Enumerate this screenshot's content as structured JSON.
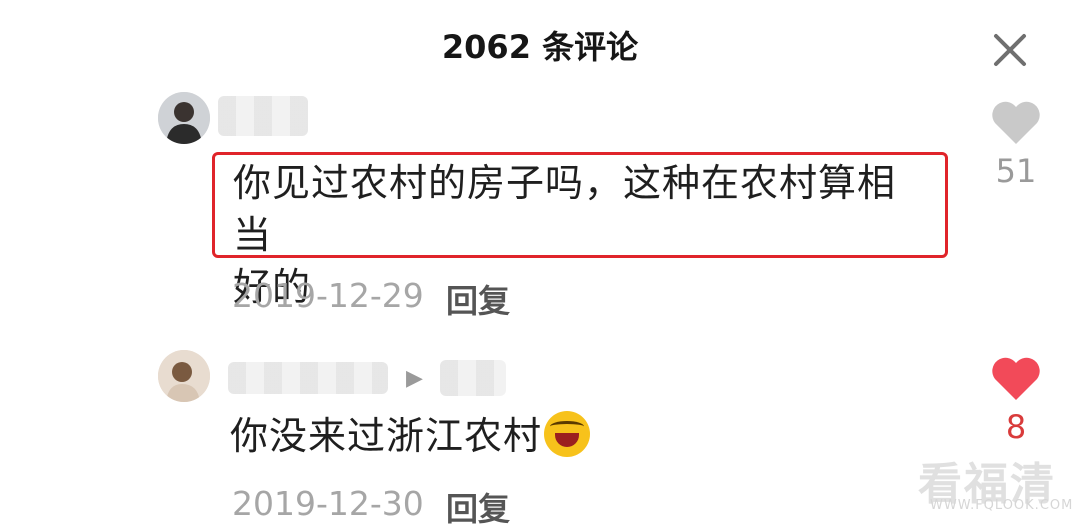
{
  "header": {
    "title": "2062 条评论",
    "close_icon": "close-icon"
  },
  "comments": [
    {
      "avatar": "avatar-person",
      "text_line1": "你见过农村的房子吗，这种在农村算相当",
      "text_line2": "好的",
      "date": "2019-12-29",
      "reply_label": "回复",
      "likes": "51",
      "liked": false,
      "highlight_color": "#e0242a"
    },
    {
      "avatar": "avatar-person",
      "text": "你没来过浙江农村",
      "emoji": "laughing-crying-emoji",
      "date": "2019-12-30",
      "reply_label": "回复",
      "likes": "8",
      "liked": true,
      "like_color": "#f24a59"
    }
  ],
  "watermark": {
    "text": "看福清",
    "sub": "WWW.FQLOOK.COM"
  }
}
